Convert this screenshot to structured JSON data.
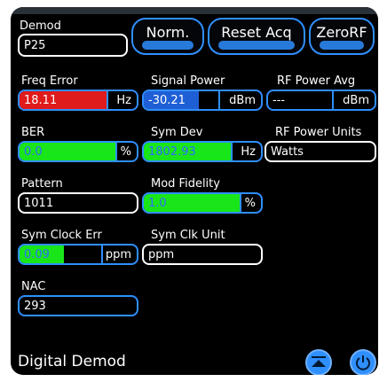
{
  "demod": {
    "label": "Demod",
    "value": "P25"
  },
  "buttons": {
    "norm": "Norm.",
    "reset_acq": "Reset Acq",
    "zero_rf": "ZeroRF"
  },
  "freq_error": {
    "label": "Freq Error",
    "value": "18.11",
    "unit": "Hz",
    "status_color": "#e01b1b"
  },
  "signal_power": {
    "label": "Signal Power",
    "value": "-30.21",
    "unit": "dBm"
  },
  "rf_power_avg": {
    "label": "RF Power Avg",
    "value": "---",
    "unit": "dBm"
  },
  "ber": {
    "label": "BER",
    "value": "0.0",
    "unit": "%",
    "status_color": "#19e619"
  },
  "sym_dev": {
    "label": "Sym Dev",
    "value": "1802.93",
    "unit": "Hz",
    "status_color": "#19e619"
  },
  "rf_power_units": {
    "label": "RF Power Units",
    "value": "Watts"
  },
  "pattern": {
    "label": "Pattern",
    "value": "1011"
  },
  "mod_fidelity": {
    "label": "Mod Fidelity",
    "value": "1.0",
    "unit": "%",
    "status_color": "#19e619"
  },
  "sym_clock_err": {
    "label": "Sym Clock Err",
    "value": "0.09",
    "unit": "ppm",
    "status_color": "#19e619"
  },
  "sym_clk_unit": {
    "label": "Sym Clk Unit",
    "value": "ppm"
  },
  "nac": {
    "label": "NAC",
    "value": "293"
  },
  "footer": {
    "title": "Digital Demod",
    "eject_icon": "eject-icon",
    "power_icon": "power-icon"
  },
  "colors": {
    "accent": "#2f8fff",
    "background": "#000000"
  }
}
